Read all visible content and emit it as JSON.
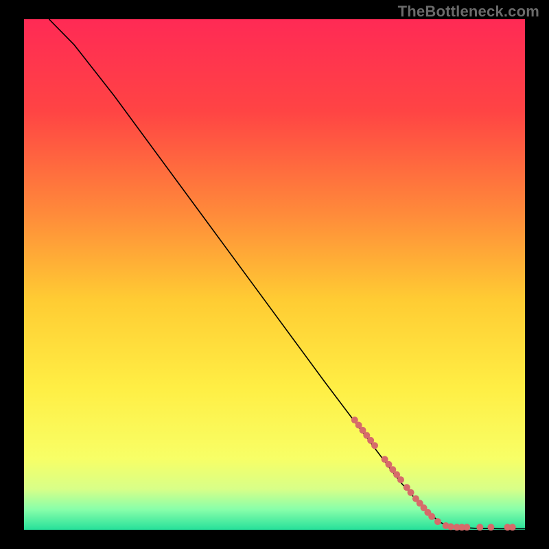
{
  "watermark": "TheBottleneck.com",
  "chart_data": {
    "type": "line",
    "title": "",
    "xlabel": "",
    "ylabel": "",
    "xlim": [
      0,
      100
    ],
    "ylim": [
      0,
      100
    ],
    "grid": false,
    "legend": false,
    "gradient_stops": [
      {
        "offset": 0,
        "color": "#ff2a55"
      },
      {
        "offset": 18,
        "color": "#ff4444"
      },
      {
        "offset": 38,
        "color": "#ff8a3a"
      },
      {
        "offset": 55,
        "color": "#ffcc33"
      },
      {
        "offset": 72,
        "color": "#ffee44"
      },
      {
        "offset": 86,
        "color": "#f8ff66"
      },
      {
        "offset": 92,
        "color": "#d8ff88"
      },
      {
        "offset": 96,
        "color": "#88ffaa"
      },
      {
        "offset": 100,
        "color": "#26e09a"
      }
    ],
    "curve": [
      {
        "x": 5,
        "y": 100
      },
      {
        "x": 6,
        "y": 99
      },
      {
        "x": 8,
        "y": 97
      },
      {
        "x": 10,
        "y": 95
      },
      {
        "x": 12,
        "y": 92.5
      },
      {
        "x": 14,
        "y": 90
      },
      {
        "x": 18,
        "y": 85
      },
      {
        "x": 24,
        "y": 77
      },
      {
        "x": 30,
        "y": 69
      },
      {
        "x": 36,
        "y": 61
      },
      {
        "x": 42,
        "y": 53
      },
      {
        "x": 48,
        "y": 45
      },
      {
        "x": 54,
        "y": 37
      },
      {
        "x": 60,
        "y": 29
      },
      {
        "x": 65,
        "y": 22.5
      },
      {
        "x": 70,
        "y": 16
      },
      {
        "x": 75,
        "y": 9.5
      },
      {
        "x": 80,
        "y": 4
      },
      {
        "x": 83,
        "y": 1.5
      },
      {
        "x": 85,
        "y": 0.6
      },
      {
        "x": 90,
        "y": 0.3
      },
      {
        "x": 95,
        "y": 0.2
      },
      {
        "x": 100,
        "y": 0.2
      }
    ],
    "dots": [
      {
        "x": 66.0,
        "y": 21.5,
        "r": 5
      },
      {
        "x": 66.8,
        "y": 20.5,
        "r": 5
      },
      {
        "x": 67.6,
        "y": 19.5,
        "r": 5
      },
      {
        "x": 68.4,
        "y": 18.5,
        "r": 5
      },
      {
        "x": 69.2,
        "y": 17.5,
        "r": 5
      },
      {
        "x": 70.0,
        "y": 16.5,
        "r": 5
      },
      {
        "x": 72.0,
        "y": 13.8,
        "r": 5
      },
      {
        "x": 72.8,
        "y": 12.8,
        "r": 5
      },
      {
        "x": 73.6,
        "y": 11.8,
        "r": 5
      },
      {
        "x": 74.4,
        "y": 10.8,
        "r": 5
      },
      {
        "x": 75.2,
        "y": 9.8,
        "r": 5
      },
      {
        "x": 76.4,
        "y": 8.3,
        "r": 5
      },
      {
        "x": 77.2,
        "y": 7.3,
        "r": 5
      },
      {
        "x": 78.2,
        "y": 6.1,
        "r": 5
      },
      {
        "x": 79.0,
        "y": 5.2,
        "r": 5
      },
      {
        "x": 79.8,
        "y": 4.3,
        "r": 5
      },
      {
        "x": 80.6,
        "y": 3.4,
        "r": 5
      },
      {
        "x": 81.4,
        "y": 2.6,
        "r": 5
      },
      {
        "x": 82.6,
        "y": 1.6,
        "r": 5
      },
      {
        "x": 84.2,
        "y": 0.8,
        "r": 5
      },
      {
        "x": 85.2,
        "y": 0.6,
        "r": 5
      },
      {
        "x": 86.4,
        "y": 0.5,
        "r": 5
      },
      {
        "x": 87.4,
        "y": 0.5,
        "r": 5
      },
      {
        "x": 88.4,
        "y": 0.5,
        "r": 5
      },
      {
        "x": 91.0,
        "y": 0.5,
        "r": 5
      },
      {
        "x": 93.2,
        "y": 0.5,
        "r": 5
      },
      {
        "x": 96.5,
        "y": 0.5,
        "r": 5
      },
      {
        "x": 97.5,
        "y": 0.5,
        "r": 5
      }
    ]
  }
}
